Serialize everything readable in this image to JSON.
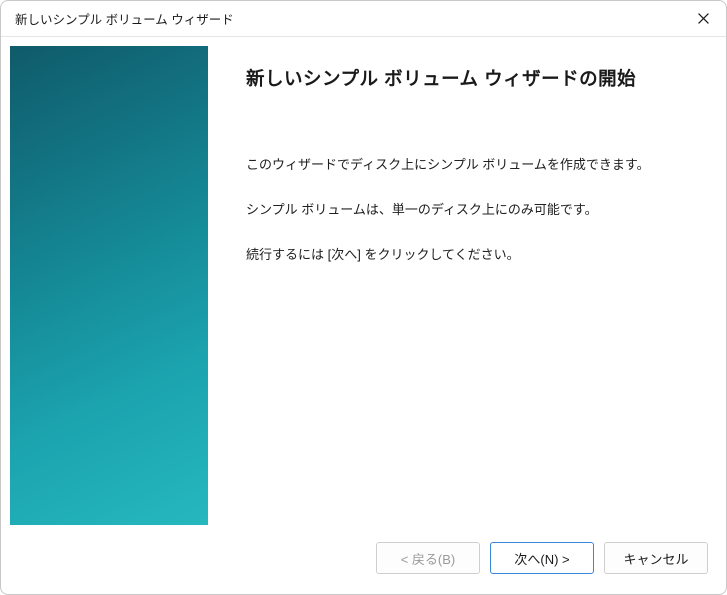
{
  "window": {
    "title": "新しいシンプル ボリューム ウィザード"
  },
  "content": {
    "heading": "新しいシンプル ボリューム ウィザードの開始",
    "para1": "このウィザードでディスク上にシンプル ボリュームを作成できます。",
    "para2": "シンプル ボリュームは、単一のディスク上にのみ可能です。",
    "para3": "続行するには [次へ] をクリックしてください。"
  },
  "buttons": {
    "back": "< 戻る(B)",
    "next": "次へ(N) >",
    "cancel": "キャンセル"
  }
}
